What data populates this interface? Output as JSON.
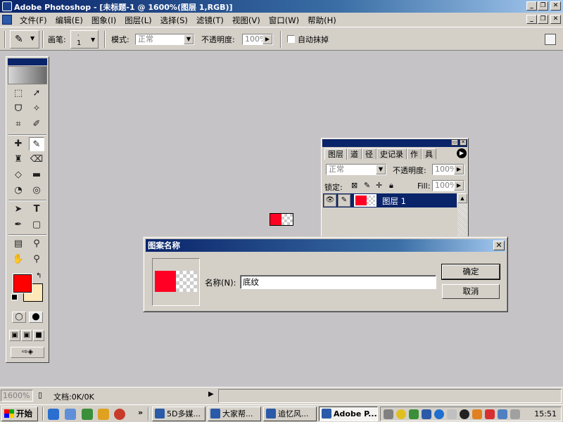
{
  "window": {
    "title": "Adobe Photoshop - [未标题-1 @ 1600%(图层 1,RGB)]"
  },
  "menu": {
    "items": [
      "文件(F)",
      "编辑(E)",
      "图象(I)",
      "图层(L)",
      "选择(S)",
      "滤镜(T)",
      "视图(V)",
      "窗口(W)",
      "帮助(H)"
    ]
  },
  "options": {
    "brush_label": "画笔:",
    "brush_size": "1",
    "mode_label": "模式:",
    "mode_value": "正常",
    "opacity_label": "不透明度:",
    "opacity_value": "100%",
    "auto_erase_label": "自动抹掉"
  },
  "layers_palette": {
    "tabs": [
      "图层",
      "道",
      "径",
      "史记录",
      "作",
      "具"
    ],
    "blend_mode": "正常",
    "opacity_label": "不透明度:",
    "opacity_value": "100%",
    "lock_label": "锁定:",
    "fill_label": "Fill:",
    "fill_value": "100%",
    "layer_name": "图层 1"
  },
  "dialog": {
    "title": "图案名称",
    "name_label": "名称(N):",
    "name_value": "底纹",
    "ok_label": "确定",
    "cancel_label": "取消"
  },
  "statusbar": {
    "zoom": "1600%",
    "doc_info": "文档:0K/0K"
  },
  "taskbar": {
    "start_label": "开始",
    "more_label": "»",
    "tasks": [
      "5D多媒...",
      "大家帮...",
      "追忆风...",
      "Adobe P..."
    ],
    "clock": "15:51"
  },
  "colors": {
    "foreground": "#ff0000",
    "background": "#fde8b8",
    "titlebar": "#0a246a"
  }
}
